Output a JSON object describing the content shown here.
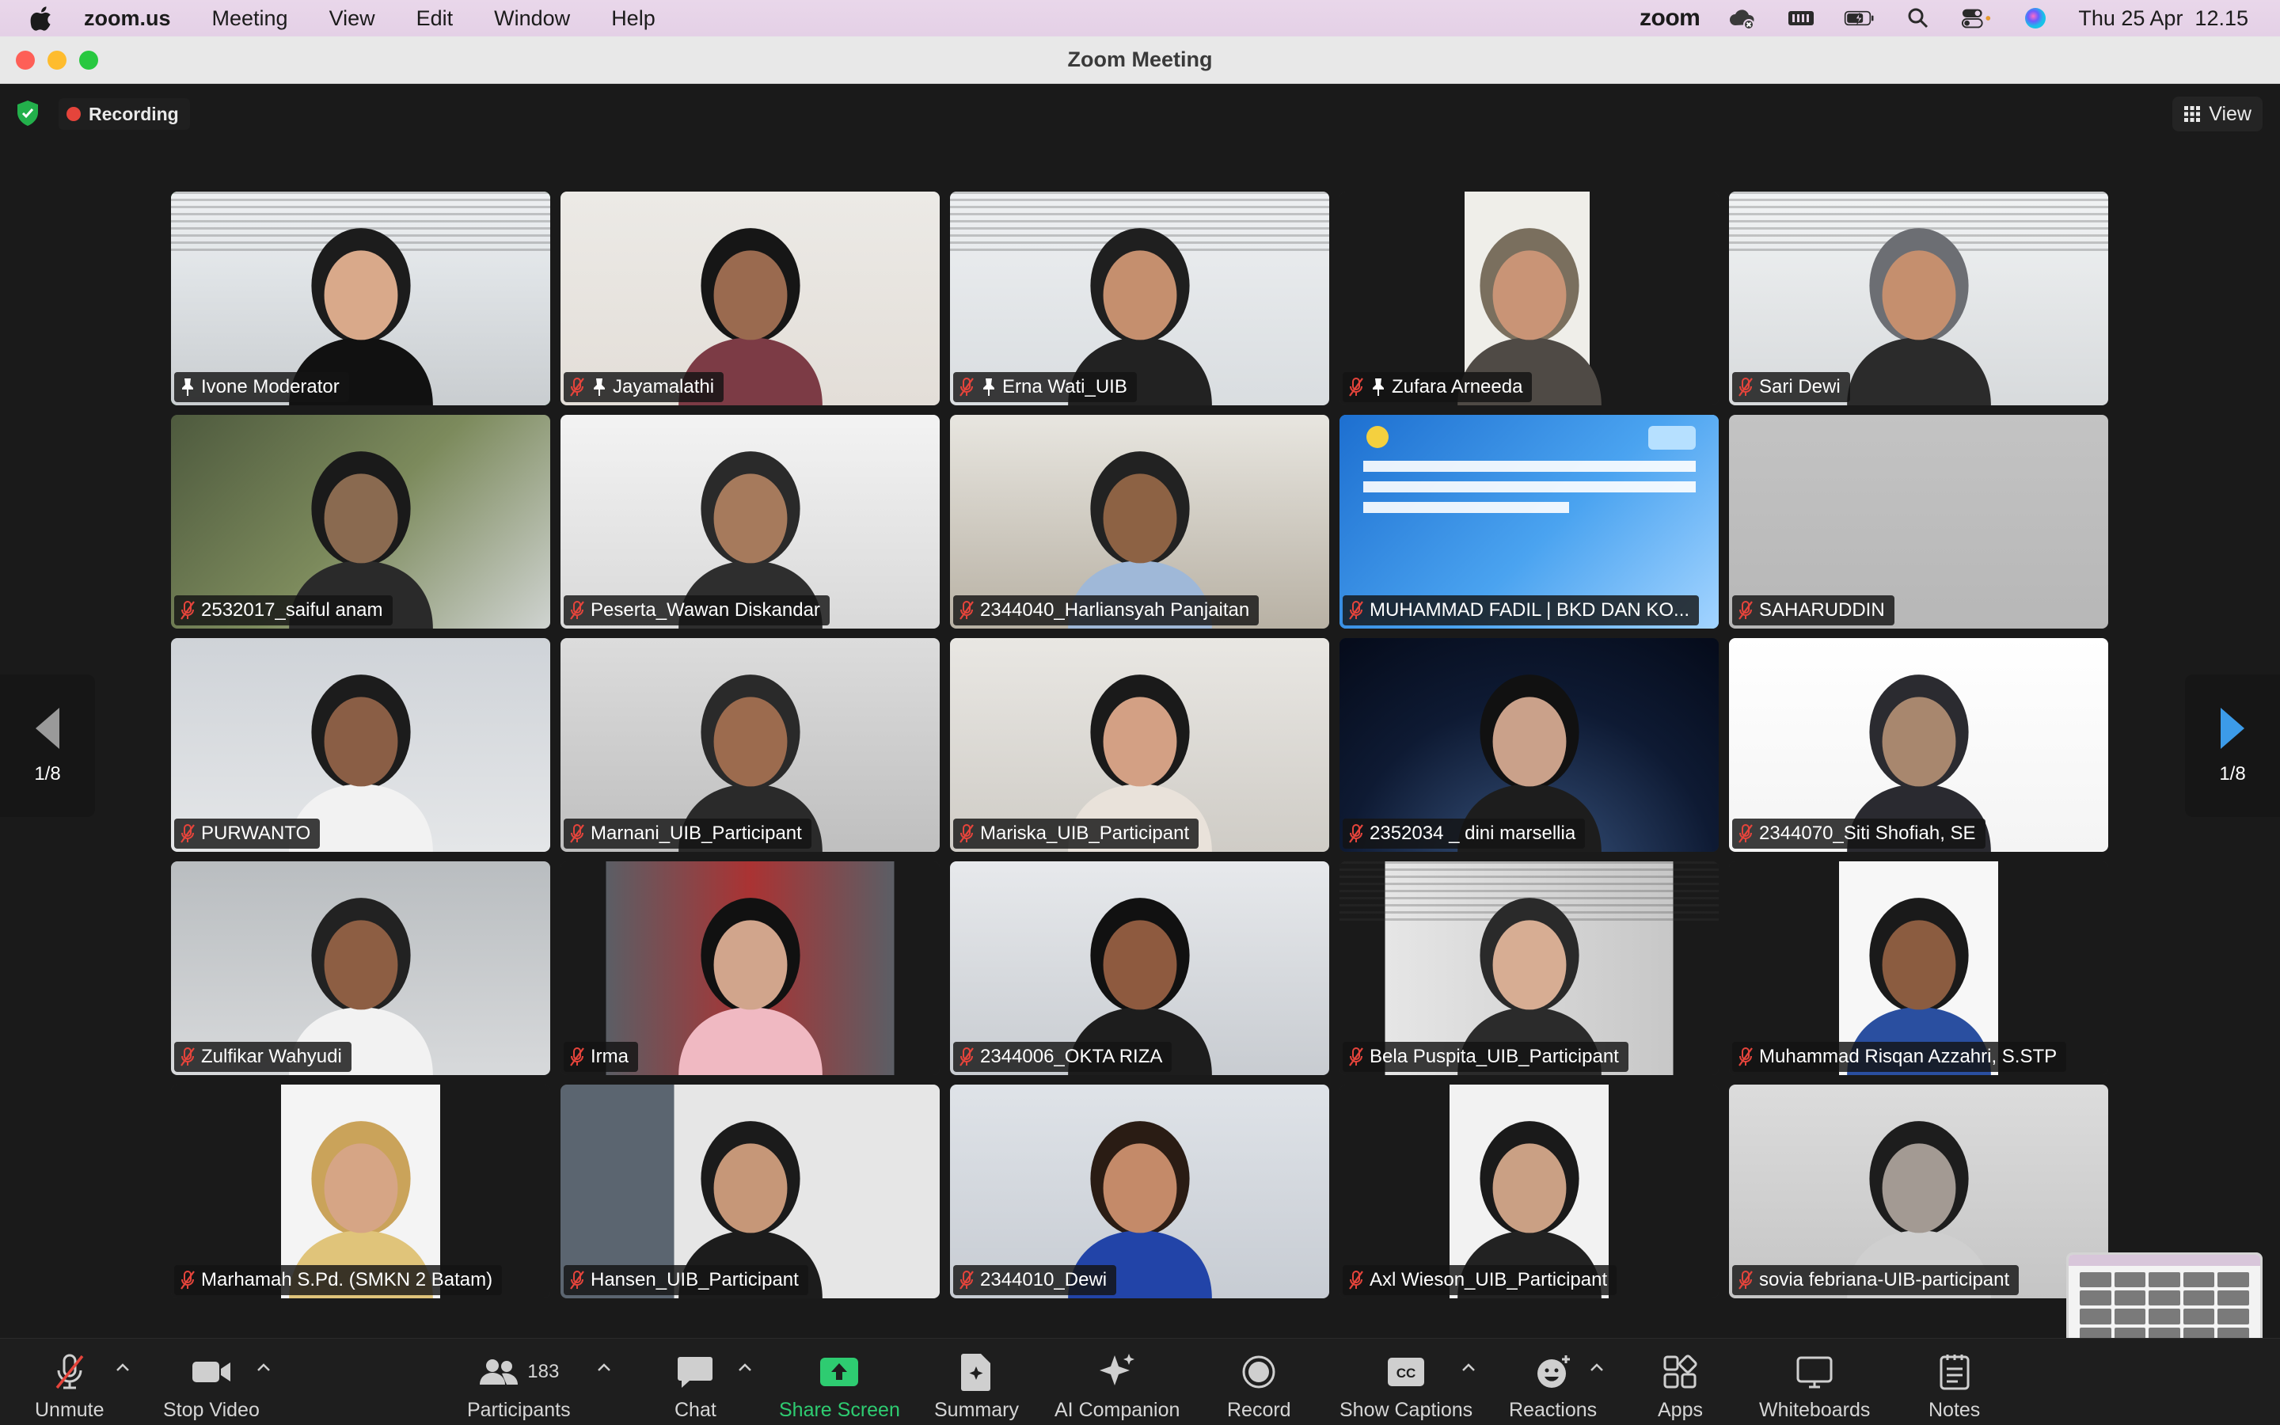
{
  "menubar": {
    "app_name": "zoom.us",
    "items": [
      "Meeting",
      "View",
      "Edit",
      "Window",
      "Help"
    ],
    "status_zoom": "zoom",
    "datetime": "Thu 25 Apr  12.15"
  },
  "window": {
    "title": "Zoom Meeting"
  },
  "meeting": {
    "recording_label": "Recording",
    "view_label": "View",
    "page_left": "1/8",
    "page_right": "1/8"
  },
  "tiles": [
    {
      "name": "Ivone Moderator",
      "muted": false,
      "pinned": true
    },
    {
      "name": "Jayamalathi",
      "muted": true,
      "pinned": true
    },
    {
      "name": "Erna Wati_UIB",
      "muted": true,
      "pinned": true
    },
    {
      "name": "Zufara Arneeda",
      "muted": true,
      "pinned": true
    },
    {
      "name": "Sari Dewi",
      "muted": true,
      "pinned": false
    },
    {
      "name": "2532017_saiful anam",
      "muted": true,
      "pinned": false
    },
    {
      "name": "Peserta_Wawan Diskandar",
      "muted": true,
      "pinned": false
    },
    {
      "name": "2344040_Harliansyah Panjaitan",
      "muted": true,
      "pinned": false
    },
    {
      "name": "MUHAMMAD FADIL  | BKD DAN KO...",
      "muted": true,
      "pinned": false
    },
    {
      "name": "SAHARUDDIN",
      "muted": true,
      "pinned": false
    },
    {
      "name": "PURWANTO",
      "muted": true,
      "pinned": false
    },
    {
      "name": "Marnani_UIB_Participant",
      "muted": true,
      "pinned": false
    },
    {
      "name": "Mariska_UIB_Participant",
      "muted": true,
      "pinned": false
    },
    {
      "name": "2352034 _ dini marsellia",
      "muted": true,
      "pinned": false
    },
    {
      "name": "2344070_Siti Shofiah, SE",
      "muted": true,
      "pinned": false
    },
    {
      "name": "Zulfikar Wahyudi",
      "muted": true,
      "pinned": false
    },
    {
      "name": "Irma",
      "muted": true,
      "pinned": false
    },
    {
      "name": "2344006_OKTA RIZA",
      "muted": true,
      "pinned": false
    },
    {
      "name": "Bela Puspita_UIB_Participant",
      "muted": true,
      "pinned": false
    },
    {
      "name": "Muhammad Risqan Azzahri, S.STP",
      "muted": true,
      "pinned": false
    },
    {
      "name": "Marhamah S.Pd. (SMKN 2 Batam)",
      "muted": true,
      "pinned": false
    },
    {
      "name": "Hansen_UIB_Participant",
      "muted": true,
      "pinned": false
    },
    {
      "name": "2344010_Dewi",
      "muted": true,
      "pinned": false
    },
    {
      "name": "Axl Wieson_UIB_Participant",
      "muted": true,
      "pinned": false
    },
    {
      "name": "sovia febriana-UIB-participant",
      "muted": true,
      "pinned": false
    }
  ],
  "toolbar": {
    "unmute": "Unmute",
    "stop_video": "Stop Video",
    "participants": "Participants",
    "participants_count": "183",
    "chat": "Chat",
    "share_screen": "Share Screen",
    "summary": "Summary",
    "ai_companion": "AI Companion",
    "record": "Record",
    "show_captions": "Show Captions",
    "reactions": "Reactions",
    "apps": "Apps",
    "whiteboards": "Whiteboards",
    "notes": "Notes"
  },
  "colors": {
    "active_speaker": "#34c759",
    "share_green": "#2ecc71",
    "muted_red": "#e5443b",
    "pager_blue": "#3c9be8"
  }
}
